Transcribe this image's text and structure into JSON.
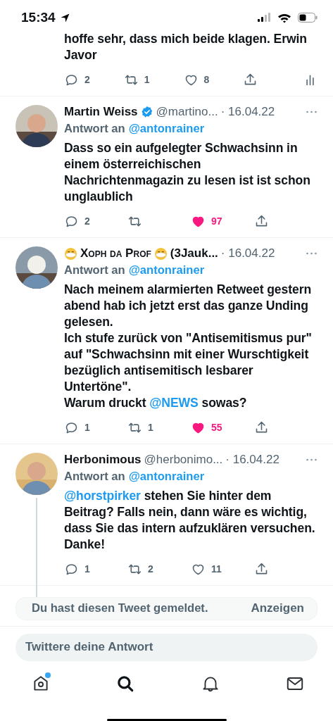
{
  "status_bar": {
    "time": "15:34"
  },
  "previous_tweet": {
    "text": "hoffe sehr, dass mich beide klagen. Erwin Javor",
    "actions": [
      {
        "kind": "reply",
        "count": "2"
      },
      {
        "kind": "retweet",
        "count": "1"
      },
      {
        "kind": "like",
        "count": "8",
        "selected": false
      },
      {
        "kind": "share"
      },
      {
        "kind": "stats"
      }
    ]
  },
  "tweets": [
    {
      "name": "Martin Weiss",
      "verified": true,
      "handle": "@martino...",
      "date": "· 16.04.22",
      "reply_label": "Antwort an",
      "reply_to": "@antonrainer",
      "thread_line": false,
      "body": [
        {
          "kind": "plain",
          "text": "Dass so ein aufgelegter Schwachsinn in einem österreichischen Nachrichtenmagazin zu lesen ist ist schon unglaublich"
        }
      ],
      "actions": [
        {
          "kind": "reply",
          "count": "2"
        },
        {
          "kind": "retweet"
        },
        {
          "kind": "like",
          "count": "97",
          "selected": true
        },
        {
          "kind": "share"
        }
      ]
    },
    {
      "name": "Xoph da Prof",
      "name_emoji": true,
      "verified": false,
      "handle": "(3Jauk...",
      "date": "· 16.04.22",
      "reply_label": "Antwort an",
      "reply_to": "@antonrainer",
      "thread_line": false,
      "body": [
        {
          "kind": "plain",
          "text": "Nach meinem alarmierten Retweet gestern abend hab ich jetzt erst das ganze Unding gelesen.\nIch stufe zurück von \"Antisemitismus pur\" auf \"Schwachsinn mit einer Wurschtigkeit bezüglich antisemitisch lesbarer Untertöne\".\nWarum druckt "
        },
        {
          "kind": "mention",
          "text": "@NEWS"
        },
        {
          "kind": "plain",
          "text": " sowas?"
        }
      ],
      "actions": [
        {
          "kind": "reply",
          "count": "1"
        },
        {
          "kind": "retweet",
          "count": "1"
        },
        {
          "kind": "like",
          "count": "55",
          "selected": true
        },
        {
          "kind": "share"
        }
      ]
    },
    {
      "name": "Herbonimous",
      "verified": false,
      "handle": "@herbonimo...",
      "date": "· 16.04.22",
      "reply_label": "Antwort an",
      "reply_to": "@antonrainer",
      "thread_line": true,
      "body": [
        {
          "kind": "mention",
          "text": "@horstpirker"
        },
        {
          "kind": "plain",
          "text": " stehen Sie hinter dem Beitrag? Falls nein, dann wäre es wichtig, dass Sie das intern aufzuklären versuchen. Danke!"
        }
      ],
      "actions": [
        {
          "kind": "reply",
          "count": "1"
        },
        {
          "kind": "retweet",
          "count": "2"
        },
        {
          "kind": "like",
          "count": "11",
          "selected": false
        },
        {
          "kind": "share"
        }
      ]
    }
  ],
  "reported_notice": {
    "text": "Du hast diesen Tweet gemeldet.",
    "button": "Anzeigen"
  },
  "reply_field": {
    "placeholder": "Twittere deine Antwort"
  },
  "tab_bar": [
    {
      "kind": "home",
      "selected": false,
      "unread": true
    },
    {
      "kind": "search",
      "selected": true,
      "unread": false
    },
    {
      "kind": "notifications",
      "selected": false,
      "unread": false
    },
    {
      "kind": "messages",
      "selected": false,
      "unread": false
    }
  ]
}
